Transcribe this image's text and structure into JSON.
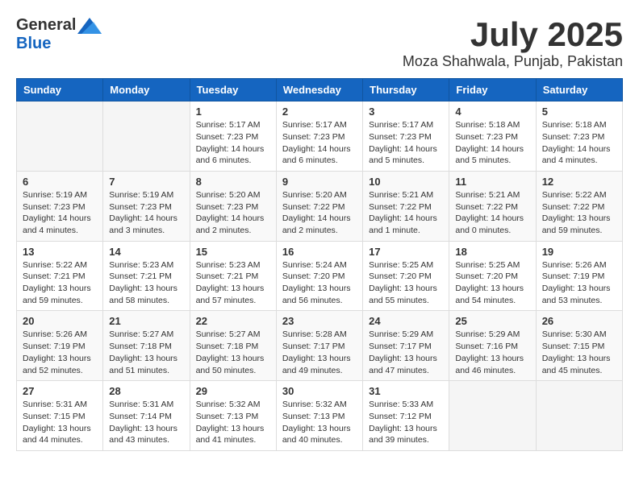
{
  "header": {
    "logo_general": "General",
    "logo_blue": "Blue",
    "month_title": "July 2025",
    "location": "Moza Shahwala, Punjab, Pakistan"
  },
  "days_of_week": [
    "Sunday",
    "Monday",
    "Tuesday",
    "Wednesday",
    "Thursday",
    "Friday",
    "Saturday"
  ],
  "weeks": [
    [
      {
        "day": "",
        "detail": ""
      },
      {
        "day": "",
        "detail": ""
      },
      {
        "day": "1",
        "detail": "Sunrise: 5:17 AM\nSunset: 7:23 PM\nDaylight: 14 hours\nand 6 minutes."
      },
      {
        "day": "2",
        "detail": "Sunrise: 5:17 AM\nSunset: 7:23 PM\nDaylight: 14 hours\nand 6 minutes."
      },
      {
        "day": "3",
        "detail": "Sunrise: 5:17 AM\nSunset: 7:23 PM\nDaylight: 14 hours\nand 5 minutes."
      },
      {
        "day": "4",
        "detail": "Sunrise: 5:18 AM\nSunset: 7:23 PM\nDaylight: 14 hours\nand 5 minutes."
      },
      {
        "day": "5",
        "detail": "Sunrise: 5:18 AM\nSunset: 7:23 PM\nDaylight: 14 hours\nand 4 minutes."
      }
    ],
    [
      {
        "day": "6",
        "detail": "Sunrise: 5:19 AM\nSunset: 7:23 PM\nDaylight: 14 hours\nand 4 minutes."
      },
      {
        "day": "7",
        "detail": "Sunrise: 5:19 AM\nSunset: 7:23 PM\nDaylight: 14 hours\nand 3 minutes."
      },
      {
        "day": "8",
        "detail": "Sunrise: 5:20 AM\nSunset: 7:23 PM\nDaylight: 14 hours\nand 2 minutes."
      },
      {
        "day": "9",
        "detail": "Sunrise: 5:20 AM\nSunset: 7:22 PM\nDaylight: 14 hours\nand 2 minutes."
      },
      {
        "day": "10",
        "detail": "Sunrise: 5:21 AM\nSunset: 7:22 PM\nDaylight: 14 hours\nand 1 minute."
      },
      {
        "day": "11",
        "detail": "Sunrise: 5:21 AM\nSunset: 7:22 PM\nDaylight: 14 hours\nand 0 minutes."
      },
      {
        "day": "12",
        "detail": "Sunrise: 5:22 AM\nSunset: 7:22 PM\nDaylight: 13 hours\nand 59 minutes."
      }
    ],
    [
      {
        "day": "13",
        "detail": "Sunrise: 5:22 AM\nSunset: 7:21 PM\nDaylight: 13 hours\nand 59 minutes."
      },
      {
        "day": "14",
        "detail": "Sunrise: 5:23 AM\nSunset: 7:21 PM\nDaylight: 13 hours\nand 58 minutes."
      },
      {
        "day": "15",
        "detail": "Sunrise: 5:23 AM\nSunset: 7:21 PM\nDaylight: 13 hours\nand 57 minutes."
      },
      {
        "day": "16",
        "detail": "Sunrise: 5:24 AM\nSunset: 7:20 PM\nDaylight: 13 hours\nand 56 minutes."
      },
      {
        "day": "17",
        "detail": "Sunrise: 5:25 AM\nSunset: 7:20 PM\nDaylight: 13 hours\nand 55 minutes."
      },
      {
        "day": "18",
        "detail": "Sunrise: 5:25 AM\nSunset: 7:20 PM\nDaylight: 13 hours\nand 54 minutes."
      },
      {
        "day": "19",
        "detail": "Sunrise: 5:26 AM\nSunset: 7:19 PM\nDaylight: 13 hours\nand 53 minutes."
      }
    ],
    [
      {
        "day": "20",
        "detail": "Sunrise: 5:26 AM\nSunset: 7:19 PM\nDaylight: 13 hours\nand 52 minutes."
      },
      {
        "day": "21",
        "detail": "Sunrise: 5:27 AM\nSunset: 7:18 PM\nDaylight: 13 hours\nand 51 minutes."
      },
      {
        "day": "22",
        "detail": "Sunrise: 5:27 AM\nSunset: 7:18 PM\nDaylight: 13 hours\nand 50 minutes."
      },
      {
        "day": "23",
        "detail": "Sunrise: 5:28 AM\nSunset: 7:17 PM\nDaylight: 13 hours\nand 49 minutes."
      },
      {
        "day": "24",
        "detail": "Sunrise: 5:29 AM\nSunset: 7:17 PM\nDaylight: 13 hours\nand 47 minutes."
      },
      {
        "day": "25",
        "detail": "Sunrise: 5:29 AM\nSunset: 7:16 PM\nDaylight: 13 hours\nand 46 minutes."
      },
      {
        "day": "26",
        "detail": "Sunrise: 5:30 AM\nSunset: 7:15 PM\nDaylight: 13 hours\nand 45 minutes."
      }
    ],
    [
      {
        "day": "27",
        "detail": "Sunrise: 5:31 AM\nSunset: 7:15 PM\nDaylight: 13 hours\nand 44 minutes."
      },
      {
        "day": "28",
        "detail": "Sunrise: 5:31 AM\nSunset: 7:14 PM\nDaylight: 13 hours\nand 43 minutes."
      },
      {
        "day": "29",
        "detail": "Sunrise: 5:32 AM\nSunset: 7:13 PM\nDaylight: 13 hours\nand 41 minutes."
      },
      {
        "day": "30",
        "detail": "Sunrise: 5:32 AM\nSunset: 7:13 PM\nDaylight: 13 hours\nand 40 minutes."
      },
      {
        "day": "31",
        "detail": "Sunrise: 5:33 AM\nSunset: 7:12 PM\nDaylight: 13 hours\nand 39 minutes."
      },
      {
        "day": "",
        "detail": ""
      },
      {
        "day": "",
        "detail": ""
      }
    ]
  ]
}
